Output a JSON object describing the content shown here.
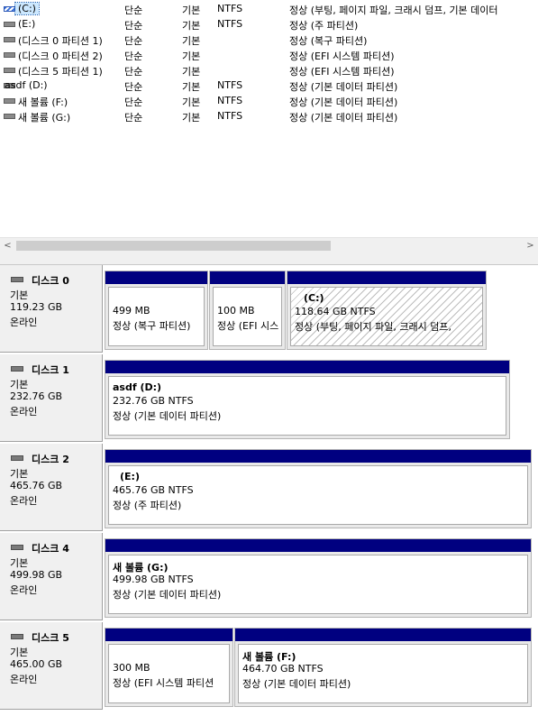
{
  "volumes": [
    {
      "name": "(C:)",
      "layout": "단순",
      "type": "기본",
      "fs": "NTFS",
      "status": "정상 (부팅, 페이지 파일, 크래시 덤프, 기본 데이터"
    },
    {
      "name": "(E:)",
      "layout": "단순",
      "type": "기본",
      "fs": "NTFS",
      "status": "정상 (주 파티션)"
    },
    {
      "name": "(디스크 0 파티션 1)",
      "layout": "단순",
      "type": "기본",
      "fs": "",
      "status": "정상 (복구 파티션)"
    },
    {
      "name": "(디스크 0 파티션 2)",
      "layout": "단순",
      "type": "기본",
      "fs": "",
      "status": "정상 (EFI 시스템 파티션)"
    },
    {
      "name": "(디스크 5 파티션 1)",
      "layout": "단순",
      "type": "기본",
      "fs": "",
      "status": "정상 (EFI 시스템 파티션)"
    },
    {
      "name": "asdf (D:)",
      "layout": "단순",
      "type": "기본",
      "fs": "NTFS",
      "status": "정상 (기본 데이터 파티션)"
    },
    {
      "name": "새 볼륨 (F:)",
      "layout": "단순",
      "type": "기본",
      "fs": "NTFS",
      "status": "정상 (기본 데이터 파티션)"
    },
    {
      "name": "새 볼륨 (G:)",
      "layout": "단순",
      "type": "기본",
      "fs": "NTFS",
      "status": "정상 (기본 데이터 파티션)"
    }
  ],
  "scrollbar": {
    "left_arrow": "<",
    "right_arrow": ">"
  },
  "disks": [
    {
      "name": "디스크 0",
      "type": "기본",
      "size": "119.23 GB",
      "state": "온라인",
      "partitions": [
        {
          "title": "",
          "size": "499 MB",
          "status": "정상 (복구 파티션)"
        },
        {
          "title": "",
          "size": "100 MB",
          "status": "정상 (EFI 시스"
        },
        {
          "title": "(C:)",
          "size": "118.64 GB NTFS",
          "status": "정상 (부팅, 페이지 파일, 크래시 덤프,"
        }
      ]
    },
    {
      "name": "디스크 1",
      "type": "기본",
      "size": "232.76 GB",
      "state": "온라인",
      "partitions": [
        {
          "title": "asdf  (D:)",
          "size": "232.76 GB NTFS",
          "status": "정상 (기본 데이터 파티션)"
        }
      ]
    },
    {
      "name": "디스크 2",
      "type": "기본",
      "size": "465.76 GB",
      "state": "온라인",
      "partitions": [
        {
          "title": "(E:)",
          "size": "465.76 GB NTFS",
          "status": "정상 (주 파티션)"
        }
      ]
    },
    {
      "name": "디스크 4",
      "type": "기본",
      "size": "499.98 GB",
      "state": "온라인",
      "partitions": [
        {
          "title": "새 볼륨  (G:)",
          "size": "499.98 GB NTFS",
          "status": "정상 (기본 데이터 파티션)"
        }
      ]
    },
    {
      "name": "디스크 5",
      "type": "기본",
      "size": "465.00 GB",
      "state": "온라인",
      "partitions": [
        {
          "title": "",
          "size": "300 MB",
          "status": "정상 (EFI 시스템 파티션"
        },
        {
          "title": "새 볼륨  (F:)",
          "size": "464.70 GB NTFS",
          "status": "정상 (기본 데이터 파티션)"
        }
      ]
    }
  ],
  "colors": {
    "partition_bar": "#000080",
    "selection": "#cce8ff",
    "panel": "#f0f0f0"
  }
}
